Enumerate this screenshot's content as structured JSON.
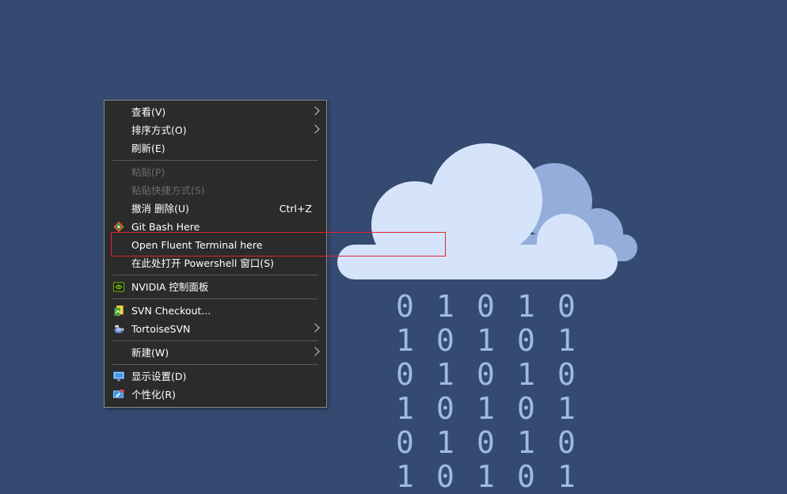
{
  "desktop": {
    "background_color": "#354a70",
    "binary_rows": [
      [
        "0",
        "1",
        "0",
        "1",
        "0"
      ],
      [
        "1",
        "0",
        "1",
        "0",
        "1"
      ],
      [
        "0",
        "1",
        "0",
        "1",
        "0"
      ],
      [
        "1",
        "0",
        "1",
        "0",
        "1"
      ],
      [
        "0",
        "1",
        "0",
        "1",
        "0"
      ],
      [
        "1",
        "0",
        "1",
        "0",
        "1"
      ]
    ]
  },
  "context_menu": {
    "view": "查看(V)",
    "sort_by": "排序方式(O)",
    "refresh": "刷新(E)",
    "paste": "粘贴(P)",
    "paste_shortcut": "粘贴快捷方式(S)",
    "undo_delete": "撤消 删除(U)",
    "undo_shortcut": "Ctrl+Z",
    "git_bash": "Git Bash Here",
    "fluent_terminal": "Open Fluent Terminal here",
    "powershell": "在此处打开 Powershell 窗口(S)",
    "nvidia": "NVIDIA 控制面板",
    "svn_checkout": "SVN Checkout...",
    "tortoise_svn": "TortoiseSVN",
    "new": "新建(W)",
    "display_settings": "显示设置(D)",
    "personalize": "个性化(R)"
  },
  "colors": {
    "highlight_box": "#e0242f",
    "cloud_front": "#d5e4fb",
    "cloud_back": "#93aedb"
  }
}
